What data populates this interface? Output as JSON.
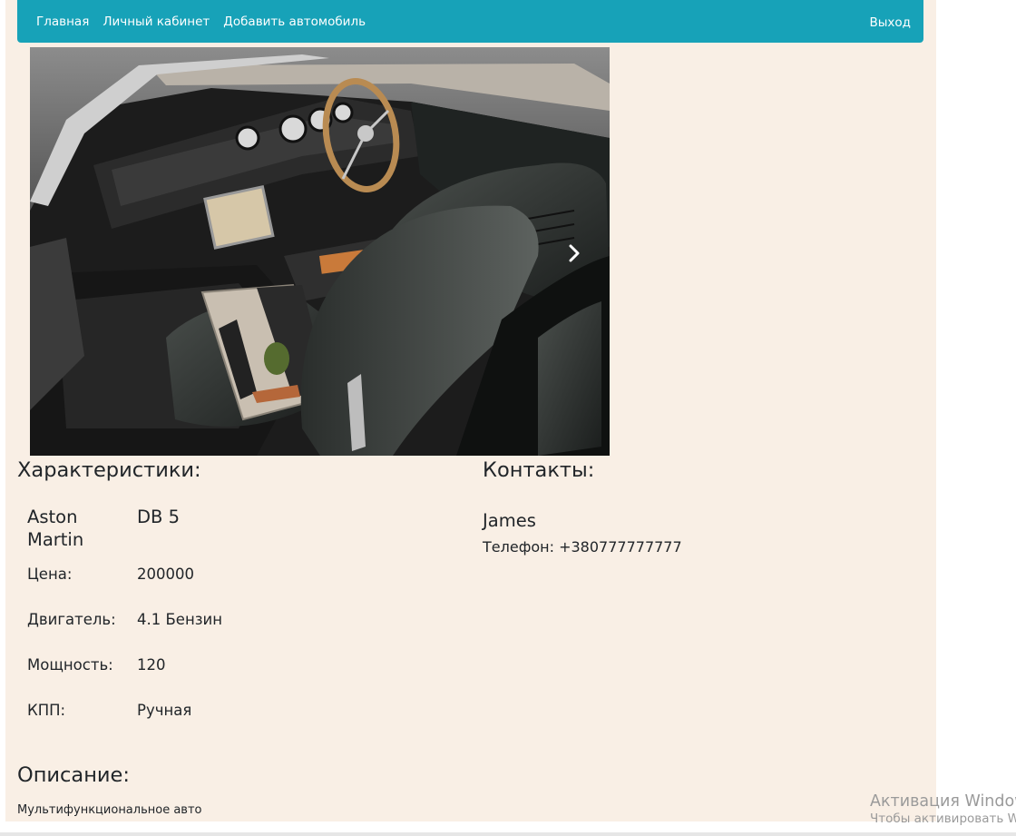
{
  "nav": {
    "links": [
      "Главная",
      "Личный кабинет",
      "Добавить автомобиль"
    ],
    "logout": "Выход"
  },
  "carousel": {
    "image_alt": "car-interior-photo",
    "next_icon": "chevron-right-icon"
  },
  "specs": {
    "title": "Характеристики:",
    "brand": "Aston Martin",
    "model": "DB 5",
    "rows": [
      {
        "label": "Цена:",
        "value": "200000"
      },
      {
        "label": "Двигатель:",
        "value": "4.1 Бензин"
      },
      {
        "label": "Мощность:",
        "value": "120"
      },
      {
        "label": "КПП:",
        "value": "Ручная"
      }
    ]
  },
  "contacts": {
    "title": "Контакты:",
    "name": "James",
    "phone": "Телефон: +380777777777"
  },
  "description": {
    "title": "Описание:",
    "text": "Мультифункциональное авто"
  },
  "watermark": {
    "line1": "Активация Windows",
    "line2": "Чтобы активировать Windows"
  },
  "colors": {
    "navbar": "#17a2b8",
    "page_bg": "#f9efe5"
  }
}
